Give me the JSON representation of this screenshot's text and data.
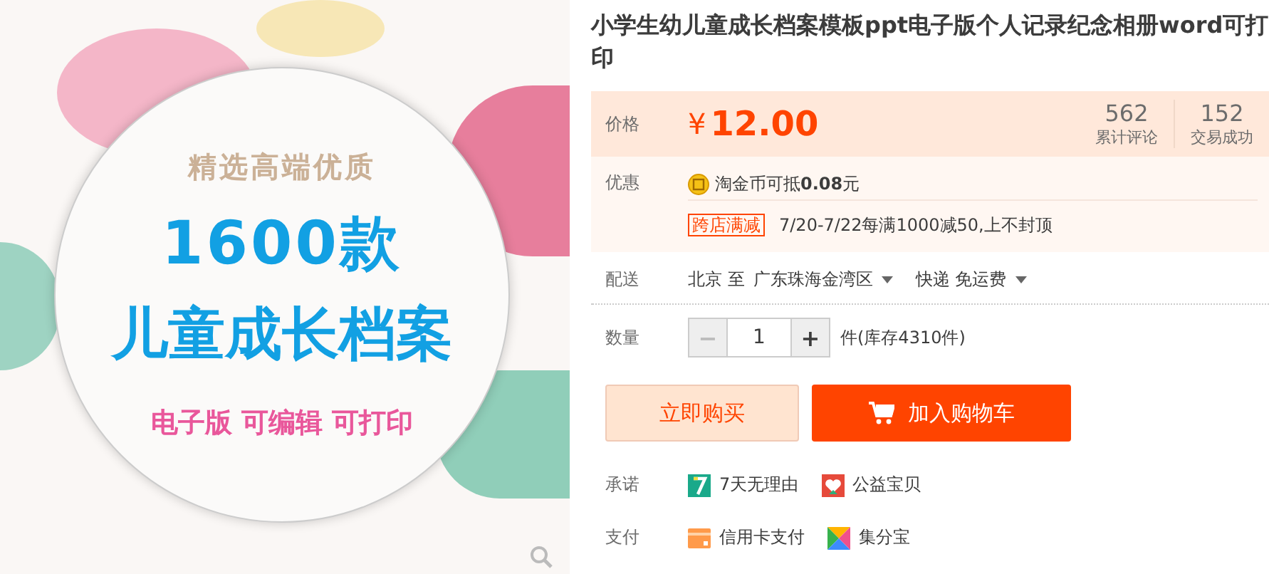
{
  "product_image": {
    "tagline": "精选高端优质",
    "headline": "1600款",
    "subtitle": "儿童成长档案",
    "features": "电子版 可编辑 可打印"
  },
  "title": "小学生幼儿童成长档案模板ppt电子版个人记录纪念相册word可打印",
  "price": {
    "label": "价格",
    "currency": "¥",
    "amount": "12.00"
  },
  "stats": [
    {
      "value": "562",
      "label": "累计评论"
    },
    {
      "value": "152",
      "label": "交易成功"
    }
  ],
  "promotions": {
    "label": "优惠",
    "items": [
      {
        "kind": "coin",
        "text": "淘金币可抵**0.08**元"
      },
      {
        "kind": "tag",
        "tag": "跨店满减",
        "text": "7/20-7/22每满1000减50,上不封顶"
      }
    ]
  },
  "delivery": {
    "label": "配送",
    "from": "北京 至",
    "to": "广东珠海金湾区",
    "method": "快递 免运费"
  },
  "quantity": {
    "label": "数量",
    "decrement": "−",
    "value": "1",
    "increment": "+",
    "stock": "件(库存4310件)"
  },
  "buttons": [
    {
      "kind": "buy",
      "label": "立即购买"
    },
    {
      "kind": "cart",
      "label": "加入购物车"
    }
  ],
  "promises": {
    "label": "承诺",
    "items": [
      {
        "kind": "seven_day",
        "text": "7天无理由"
      },
      {
        "kind": "charity",
        "text": "公益宝贝"
      }
    ]
  },
  "payment": {
    "label": "支付",
    "items": [
      {
        "kind": "credit_card",
        "text": "信用卡支付"
      },
      {
        "kind": "points",
        "text": "集分宝"
      }
    ]
  }
}
